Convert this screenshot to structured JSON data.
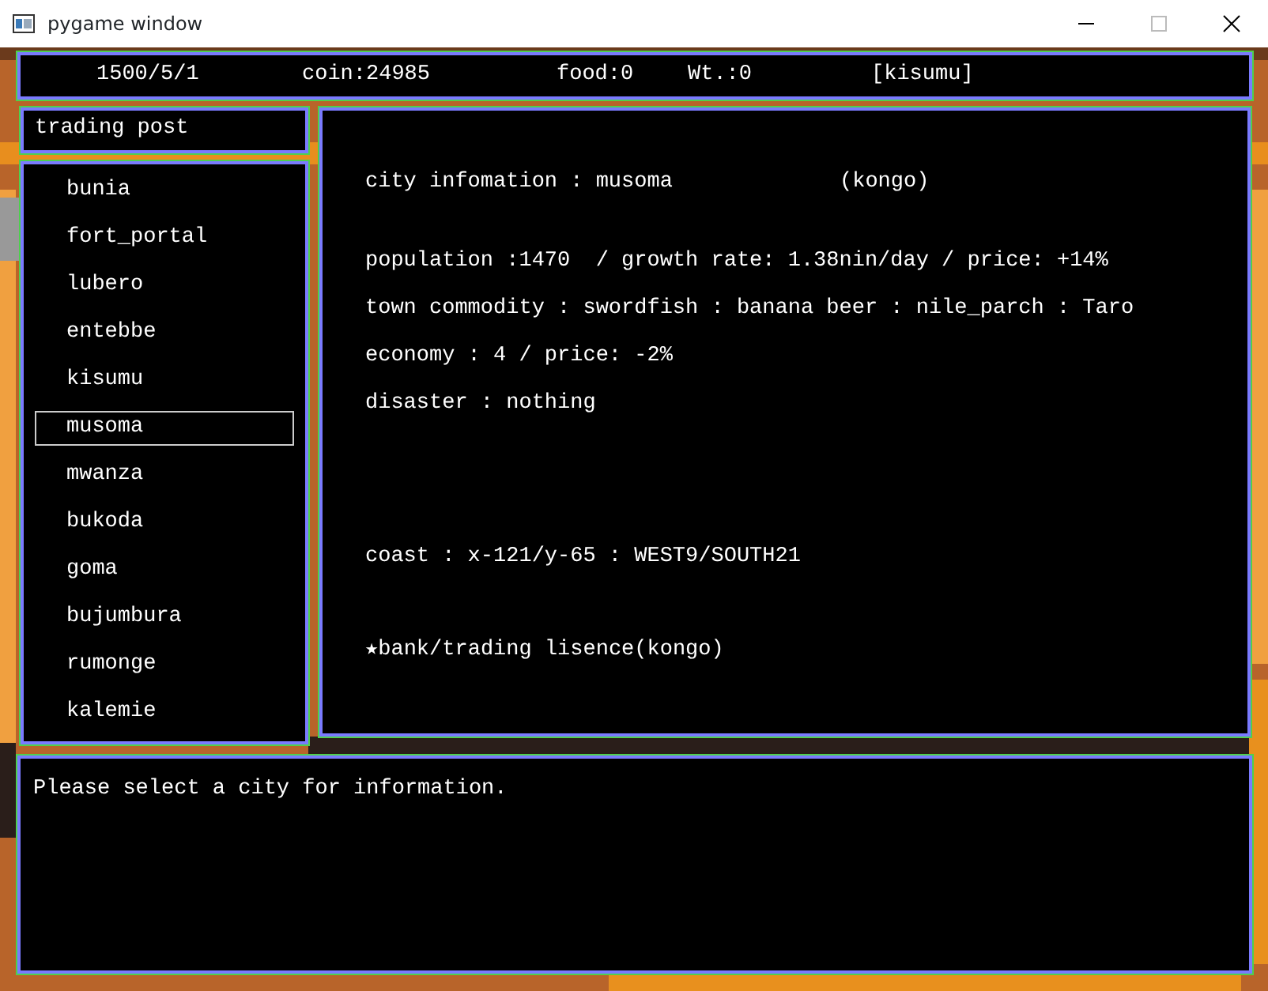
{
  "window": {
    "title": "pygame window"
  },
  "status_bar": [
    "1500/5/1",
    "coin:24985",
    "food:0",
    "Wt.:0",
    "[kisumu]"
  ],
  "mode": "trading post",
  "cities": [
    {
      "name": "bunia",
      "selected": false
    },
    {
      "name": "fort_portal",
      "selected": false
    },
    {
      "name": "lubero",
      "selected": false
    },
    {
      "name": "entebbe",
      "selected": false
    },
    {
      "name": "kisumu",
      "selected": false
    },
    {
      "name": "musoma",
      "selected": true
    },
    {
      "name": "mwanza",
      "selected": false
    },
    {
      "name": "bukoda",
      "selected": false
    },
    {
      "name": "goma",
      "selected": false
    },
    {
      "name": "bujumbura",
      "selected": false
    },
    {
      "name": "rumonge",
      "selected": false
    },
    {
      "name": "kalemie",
      "selected": false
    }
  ],
  "info": {
    "title": "city infomation : musoma",
    "region": "(kongo)",
    "lines": [
      "population :1470  / growth rate: 1.38nin/day / price: +14%",
      "town commodity : swordfish : banana beer : nile_parch : Taro",
      "economy : 4 / price: -2%",
      "disaster : nothing"
    ],
    "coast": "coast : x-121/y-65 : WEST9/SOUTH21",
    "licence": "★bank/trading lisence(kongo)"
  },
  "message": "Please select a city for information."
}
